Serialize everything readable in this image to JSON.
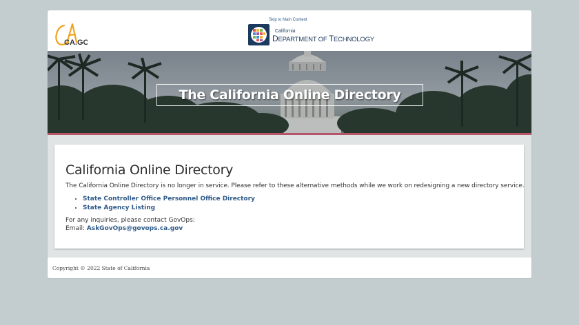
{
  "header": {
    "ca_logo_text": "CA.GOV",
    "skip_link": "Skip to Main Content",
    "cdt_small": "California",
    "cdt_big_d": "D",
    "cdt_big_rest1": "EPARTMENT OF ",
    "cdt_big_t": "T",
    "cdt_big_rest2": "ECHNOLOGY"
  },
  "banner": {
    "title": "The California Online Directory",
    "stripe_color": "#b5556a"
  },
  "main": {
    "heading": "California Online Directory",
    "intro": "The California Online Directory is no longer in service. Please refer to these alternative methods while we work on redesigning a new directory service.",
    "links": [
      "State Controller Office Personnel Office Directory",
      "State Agency Listing"
    ],
    "inquiry": "For any inquiries, please contact GovOps:",
    "email_label": "Email: ",
    "email_link": "AskGovOps@govops.ca.gov",
    "link_color": "#2f5a89"
  },
  "footer": {
    "copyright": "Copyright © 2022 State of California"
  },
  "icons": {
    "ca_logo": "ca-gov-logo",
    "cdt_logo": "cdt-badge-icon"
  }
}
